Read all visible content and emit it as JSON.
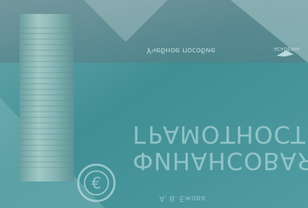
{
  "book": {
    "title_line1": "ФИНАНСОВАЯ",
    "title_line2": "ГРАМОТНОСТЬ",
    "subtitle": "Учебное пособие",
    "author": "А. В. Ежова",
    "publisher": "ACADEMIA"
  },
  "colors": {
    "teal": "#3f8f95",
    "teal_light": "#78c4c7",
    "text": "#d5f0f1"
  },
  "icons": {
    "euro": "euro-icon",
    "publisher_logo": "academia-logo-icon"
  }
}
